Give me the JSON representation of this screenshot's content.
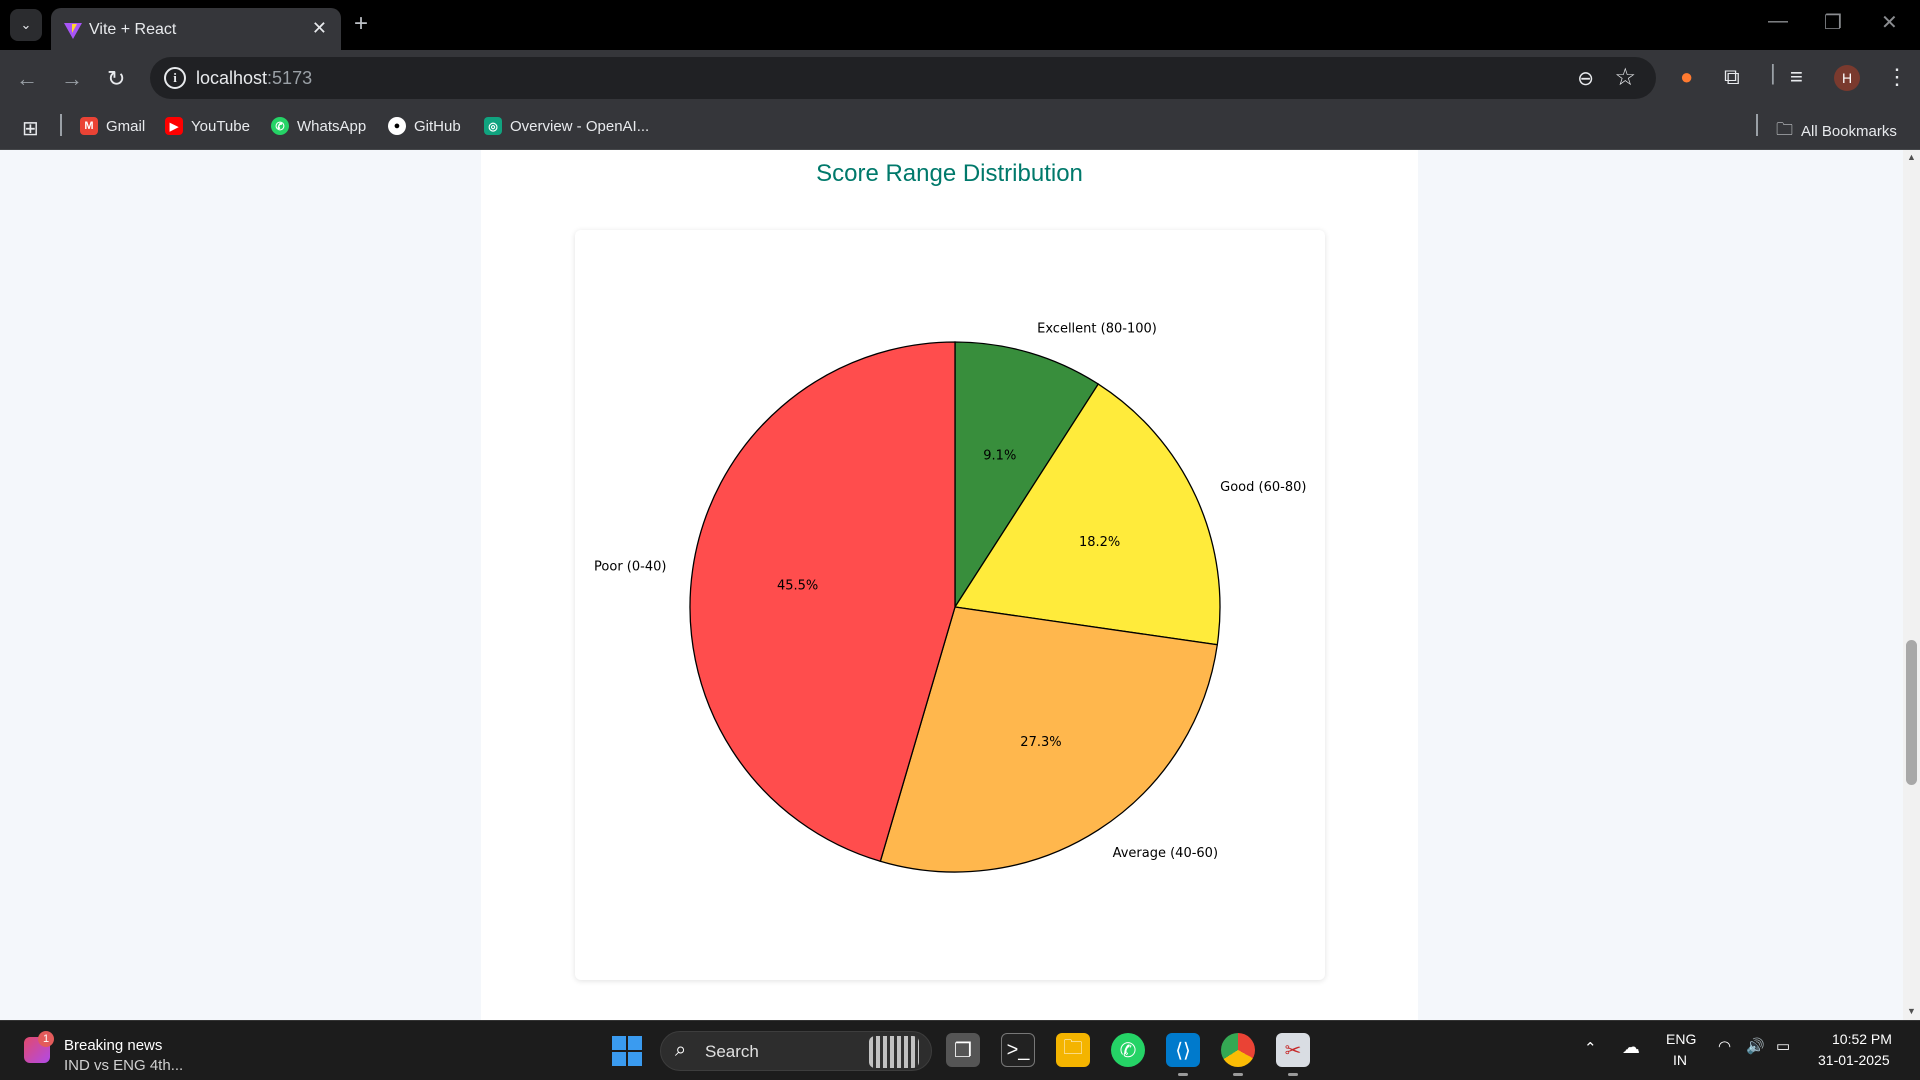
{
  "browser": {
    "tab_title": "Vite + React",
    "url_host": "localhost",
    "url_port": ":5173",
    "bookmarks": [
      {
        "label": "Gmail",
        "icon": "gmail-icon",
        "color": "#ea4335"
      },
      {
        "label": "YouTube",
        "icon": "youtube-icon",
        "color": "#ff0000"
      },
      {
        "label": "WhatsApp",
        "icon": "whatsapp-icon",
        "color": "#25d366"
      },
      {
        "label": "GitHub",
        "icon": "github-icon",
        "color": "#ffffff"
      },
      {
        "label": "Overview - OpenAI...",
        "icon": "openai-icon",
        "color": "#10a37f"
      }
    ],
    "all_bookmarks": "All Bookmarks",
    "profile_initial": "H"
  },
  "page": {
    "chart_title": "Score Range Distribution"
  },
  "chart_data": {
    "type": "pie",
    "title": "Score Range Distribution",
    "start_angle_deg": 90,
    "direction": "clockwise",
    "edge_color": "#000000",
    "slices": [
      {
        "label": "Excellent (80-100)",
        "value": 9.1,
        "pct_label": "9.1%",
        "color": "#388e3c"
      },
      {
        "label": "Good (60-80)",
        "value": 18.2,
        "pct_label": "18.2%",
        "color": "#ffeb3b"
      },
      {
        "label": "Average (40-60)",
        "value": 27.3,
        "pct_label": "27.3%",
        "color": "#ffb74d"
      },
      {
        "label": "Poor (0-40)",
        "value": 45.5,
        "pct_label": "45.5%",
        "color": "#ff4d4d"
      }
    ]
  },
  "taskbar": {
    "news_badge": "1",
    "news_title": "Breaking news",
    "news_subtitle": "IND vs ENG 4th...",
    "search_label": "Search",
    "lang_line1": "ENG",
    "lang_line2": "IN",
    "time": "10:52 PM",
    "date": "31-01-2025"
  }
}
